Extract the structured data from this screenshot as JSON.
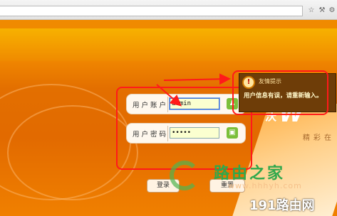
{
  "browser": {
    "icons": [
      "star-icon",
      "tools-icon",
      "settings-icon"
    ]
  },
  "brand": {
    "char": "沃",
    "logo": "W",
    "sub": "精彩在"
  },
  "login": {
    "username_label": "用户账户",
    "username_value": "admin",
    "password_label": "用户密码",
    "password_value": "•••••",
    "login_button": "登录",
    "reset_button": "重置"
  },
  "tooltip": {
    "title": "友情提示",
    "message": "用户信息有误，请重新输入。",
    "icon": "!"
  },
  "watermarks": {
    "site_name": "路由之家",
    "site_url": "www.hhhyh.com",
    "brand": "191路由网"
  },
  "colors": {
    "accent_orange": "#e86f00",
    "annotation_red": "#ff1a1a",
    "tooltip_bg": "#6e3d08",
    "watermark_green": "#2fa84c"
  }
}
